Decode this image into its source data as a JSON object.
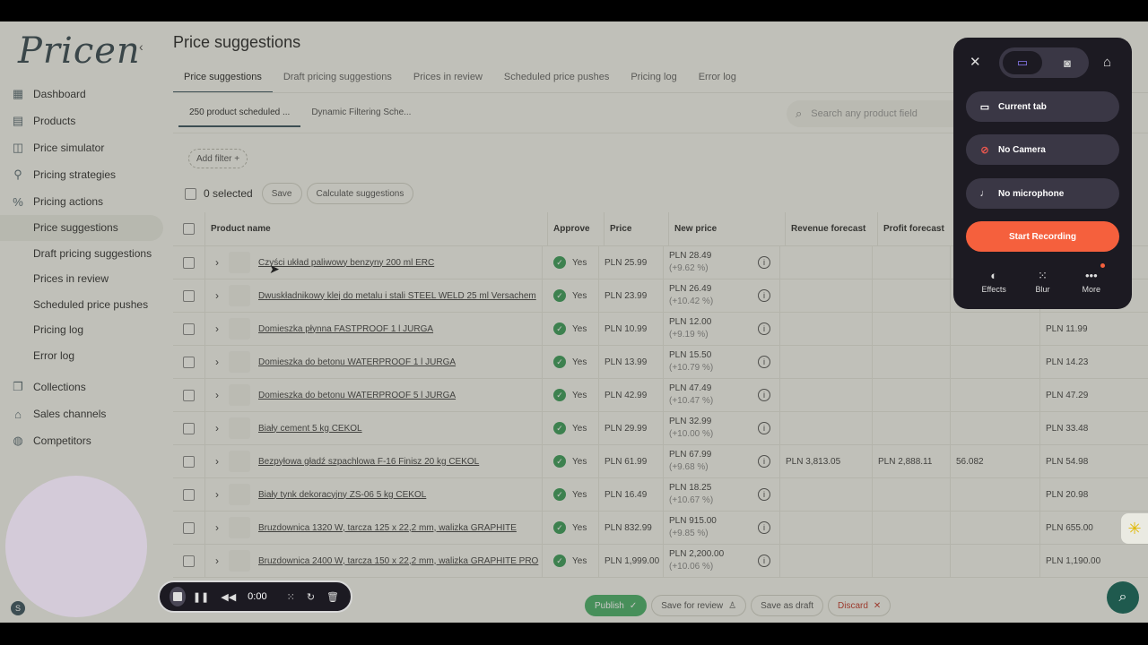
{
  "app": {
    "logo": "Pricen",
    "collapse_icon": "‹",
    "user_initial": "S"
  },
  "sidebar": {
    "items": [
      {
        "label": "Dashboard",
        "icon": "dashboard-icon"
      },
      {
        "label": "Products",
        "icon": "products-icon"
      },
      {
        "label": "Price simulator",
        "icon": "chart-icon"
      },
      {
        "label": "Pricing strategies",
        "icon": "strategy-icon"
      },
      {
        "label": "Pricing actions",
        "icon": "percent-icon"
      }
    ],
    "subitems": [
      {
        "label": "Price suggestions",
        "active": true
      },
      {
        "label": "Draft pricing suggestions"
      },
      {
        "label": "Prices in review"
      },
      {
        "label": "Scheduled price pushes"
      },
      {
        "label": "Pricing log"
      },
      {
        "label": "Error log"
      }
    ],
    "items2": [
      {
        "label": "Collections",
        "icon": "collections-icon"
      },
      {
        "label": "Sales channels",
        "icon": "store-icon"
      },
      {
        "label": "Competitors",
        "icon": "globe-icon"
      }
    ]
  },
  "main": {
    "title": "Price suggestions",
    "tabs": [
      "Price suggestions",
      "Draft pricing suggestions",
      "Prices in review",
      "Scheduled price pushes",
      "Pricing log",
      "Error log"
    ],
    "subtabs": [
      "250 product scheduled ...",
      "Dynamic Filtering Sche..."
    ],
    "search_placeholder": "Search any product field",
    "add_filter": "Add filter +",
    "selected": "0 selected",
    "save": "Save",
    "calculate": "Calculate suggestions"
  },
  "table": {
    "headers": {
      "name": "Product name",
      "approve": "Approve",
      "price": "Price",
      "new_price": "New price",
      "revenue": "Revenue forecast",
      "profit": "Profit forecast"
    },
    "rows": [
      {
        "name": "Czyści układ paliwowy benzyny 200 ml ERC",
        "approve": "Yes",
        "price": "PLN 25.99",
        "new_price": "PLN 28.49",
        "pct": "(+9.62 %)",
        "revenue": "",
        "profit": "",
        "x": "",
        "last": ""
      },
      {
        "name": "Dwuskładnikowy klej do metalu i stali STEEL WELD 25 ml Versachem",
        "approve": "Yes",
        "price": "PLN 23.99",
        "new_price": "PLN 26.49",
        "pct": "(+10.42 %)",
        "revenue": "",
        "profit": "",
        "x": "",
        "last": ""
      },
      {
        "name": "Domieszka płynna FASTPROOF 1 l JURGA",
        "approve": "Yes",
        "price": "PLN 10.99",
        "new_price": "PLN 12.00",
        "pct": "(+9.19 %)",
        "revenue": "",
        "profit": "",
        "x": "",
        "last": "PLN 11.99"
      },
      {
        "name": "Domieszka do betonu WATERPROOF 1 l JURGA",
        "approve": "Yes",
        "price": "PLN 13.99",
        "new_price": "PLN 15.50",
        "pct": "(+10.79 %)",
        "revenue": "",
        "profit": "",
        "x": "",
        "last": "PLN 14.23"
      },
      {
        "name": "Domieszka do betonu WATERPROOF 5 l JURGA",
        "approve": "Yes",
        "price": "PLN 42.99",
        "new_price": "PLN 47.49",
        "pct": "(+10.47 %)",
        "revenue": "",
        "profit": "",
        "x": "",
        "last": "PLN 47.29"
      },
      {
        "name": "Biały cement 5 kg CEKOL",
        "approve": "Yes",
        "price": "PLN 29.99",
        "new_price": "PLN 32.99",
        "pct": "(+10.00 %)",
        "revenue": "",
        "profit": "",
        "x": "",
        "last": "PLN 33.48"
      },
      {
        "name": "Bezpyłowa gładź szpachlowa F-16 Finisz 20 kg CEKOL",
        "approve": "Yes",
        "price": "PLN 61.99",
        "new_price": "PLN 67.99",
        "pct": "(+9.68 %)",
        "revenue": "PLN 3,813.05",
        "profit": "PLN 2,888.11",
        "x": "56.082",
        "last": "PLN 54.98"
      },
      {
        "name": "Biały tynk dekoracyjny ZS-06 5 kg CEKOL",
        "approve": "Yes",
        "price": "PLN 16.49",
        "new_price": "PLN 18.25",
        "pct": "(+10.67 %)",
        "revenue": "",
        "profit": "",
        "x": "",
        "last": "PLN 20.98"
      },
      {
        "name": "Bruzdownica 1320 W, tarcza 125 x 22,2 mm, walizka GRAPHITE",
        "approve": "Yes",
        "price": "PLN 832.99",
        "new_price": "PLN 915.00",
        "pct": "(+9.85 %)",
        "revenue": "",
        "profit": "",
        "x": "",
        "last": "PLN 655.00"
      },
      {
        "name": "Bruzdownica 2400 W, tarcza 150 x 22,2 mm, walizka GRAPHITE PRO",
        "approve": "Yes",
        "price": "PLN 1,999.00",
        "new_price": "PLN 2,200.00",
        "pct": "(+10.06 %)",
        "revenue": "",
        "profit": "",
        "x": "",
        "last": "PLN 1,190.00"
      }
    ]
  },
  "bottombar": {
    "publish": "Publish",
    "save_review": "Save for review",
    "save_draft": "Save as draft",
    "discard": "Discard"
  },
  "recorder": {
    "current_tab": "Current tab",
    "no_camera": "No Camera",
    "no_mic": "No microphone",
    "start": "Start Recording",
    "effects": "Effects",
    "blur": "Blur",
    "more": "More",
    "time": "0:00",
    "accent": "#f5603d"
  }
}
